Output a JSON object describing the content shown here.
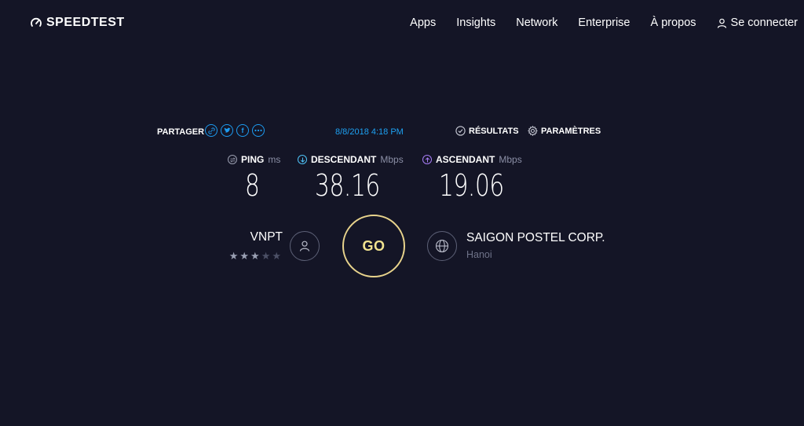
{
  "header": {
    "logo": "SPEEDTEST",
    "nav": [
      "Apps",
      "Insights",
      "Network",
      "Enterprise",
      "À propos"
    ],
    "login": "Se connecter"
  },
  "share": {
    "label": "PARTAGER",
    "icons": [
      "link-icon",
      "twitter-icon",
      "facebook-icon",
      "more-icon"
    ],
    "timestamp": "8/8/2018 4:18 PM",
    "results": "RÉSULTATS",
    "settings": "PARAMÈTRES"
  },
  "metrics": {
    "ping": {
      "label": "PING",
      "unit": "ms",
      "value": "8"
    },
    "download": {
      "label": "DESCENDANT",
      "unit": "Mbps",
      "value": "38.16"
    },
    "upload": {
      "label": "ASCENDANT",
      "unit": "Mbps",
      "value": "19.06"
    }
  },
  "isp": {
    "name": "VNPT",
    "rating": 3,
    "max_rating": 5
  },
  "go_label": "GO",
  "server": {
    "name": "SAIGON POSTEL CORP.",
    "city": "Hanoi"
  },
  "colors": {
    "background": "#141526",
    "accent_blue": "#1da1f2",
    "go_ring": "#e8d38c",
    "download_icon": "#4fc3f7",
    "upload_icon": "#a67cf5"
  }
}
